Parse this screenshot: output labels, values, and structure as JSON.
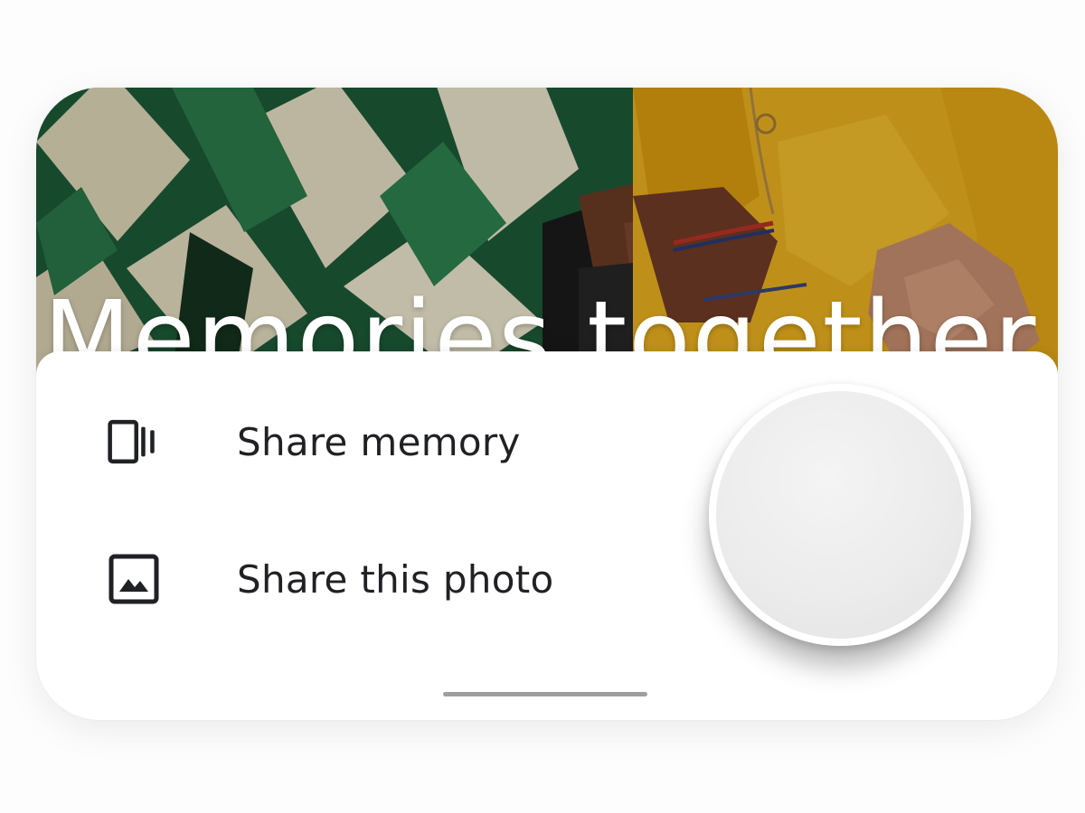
{
  "photo": {
    "title": "Memories together"
  },
  "share_sheet": {
    "items": [
      {
        "label": "Share memory",
        "icon": "memory-stack-icon"
      },
      {
        "label": "Share this photo",
        "icon": "image-icon"
      }
    ]
  },
  "colors": {
    "text": "#202124",
    "sweater_green": "#1f6b3f",
    "sweater_cream": "#e6dfc2",
    "shirt_yellow": "#e9b01f",
    "handle": "#9e9e9e"
  }
}
